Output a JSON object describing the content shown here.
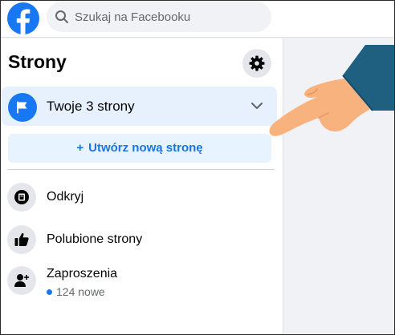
{
  "header": {
    "search_placeholder": "Szukaj na Facebooku"
  },
  "sidebar": {
    "title": "Strony",
    "your_pages_label": "Twoje 3 strony",
    "create_page_label": "Utwórz nową stronę",
    "items": [
      {
        "label": "Odkryj",
        "icon": "discover-icon"
      },
      {
        "label": "Polubione strony",
        "icon": "thumbs-up-icon"
      },
      {
        "label": "Zaproszenia",
        "sub": "124 nowe",
        "icon": "invite-person-icon"
      }
    ]
  },
  "colors": {
    "brand_blue": "#1877f2",
    "selected_row_bg": "#e7f0fd",
    "create_button_bg": "#e7f3ff",
    "hand_skin": "#f7b27d",
    "sleeve": "#1f5f80"
  }
}
